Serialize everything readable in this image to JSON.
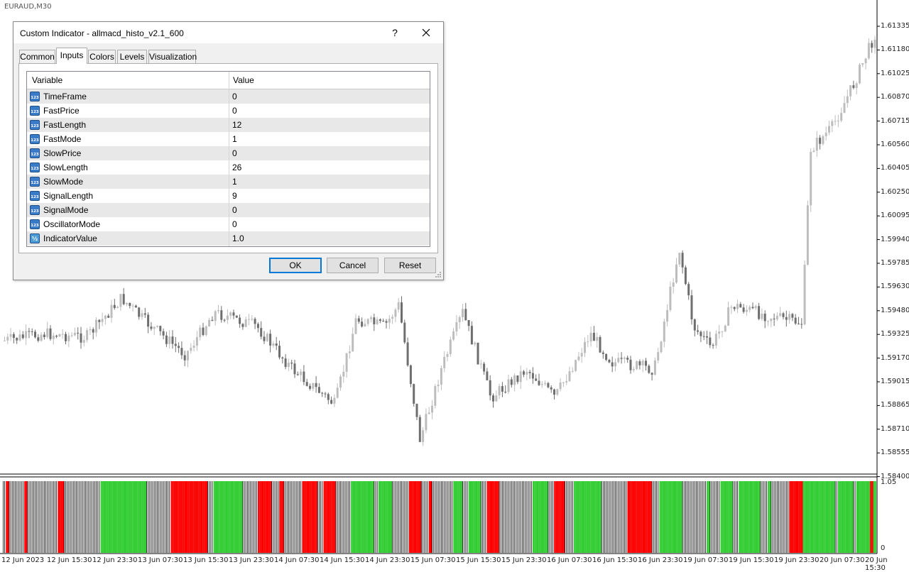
{
  "symbol": "EURAUD,M30",
  "price_axis": [
    "1.61335",
    "1.61180",
    "1.61025",
    "1.60870",
    "1.60715",
    "1.60560",
    "1.60405",
    "1.60250",
    "1.60095",
    "1.59940",
    "1.59785",
    "1.59630",
    "1.59480",
    "1.59325",
    "1.59170",
    "1.59015",
    "1.58865",
    "1.58710",
    "1.58555",
    "1.58400"
  ],
  "time_axis": [
    "12 Jun 2023",
    "12 Jun 15:30",
    "12 Jun 23:30",
    "13 Jun 07:30",
    "13 Jun 15:30",
    "13 Jun 23:30",
    "14 Jun 07:30",
    "14 Jun 15:30",
    "14 Jun 23:30",
    "15 Jun 07:30",
    "15 Jun 15:30",
    "15 Jun 23:30",
    "16 Jun 07:30",
    "16 Jun 15:30",
    "16 Jun 23:30",
    "19 Jun 07:30",
    "19 Jun 15:30",
    "19 Jun 23:30",
    "20 Jun 07:30",
    "20 Jun 15:30"
  ],
  "subwindow_axis": [
    "1.05",
    "0"
  ],
  "colors": {
    "up_candle": "#bdbdbd",
    "down_candle": "#6e6e6e",
    "histo_green": "#32cd32",
    "histo_red": "#ff0000",
    "accent": "#0078d7"
  },
  "dialog": {
    "title": "Custom Indicator - allmacd_histo_v2.1_600",
    "help_label": "?",
    "close_icon": "close-icon",
    "tabs": [
      {
        "label": "Common"
      },
      {
        "label": "Inputs"
      },
      {
        "label": "Colors"
      },
      {
        "label": "Levels"
      },
      {
        "label": "Visualization"
      }
    ],
    "active_tab": "Inputs",
    "table": {
      "col_variable": "Variable",
      "col_value": "Value",
      "rows": [
        {
          "name": "TimeFrame",
          "value": "0",
          "icon": "int-icon"
        },
        {
          "name": "FastPrice",
          "value": "0",
          "icon": "int-icon"
        },
        {
          "name": "FastLength",
          "value": "12",
          "icon": "int-icon"
        },
        {
          "name": "FastMode",
          "value": "1",
          "icon": "int-icon"
        },
        {
          "name": "SlowPrice",
          "value": "0",
          "icon": "int-icon"
        },
        {
          "name": "SlowLength",
          "value": "26",
          "icon": "int-icon"
        },
        {
          "name": "SlowMode",
          "value": "1",
          "icon": "int-icon"
        },
        {
          "name": "SignalLength",
          "value": "9",
          "icon": "int-icon"
        },
        {
          "name": "SignalMode",
          "value": "0",
          "icon": "int-icon"
        },
        {
          "name": "OscillatorMode",
          "value": "0",
          "icon": "int-icon"
        },
        {
          "name": "IndicatorValue",
          "value": "1.0",
          "icon": "double-icon"
        }
      ]
    },
    "buttons": {
      "ok": "OK",
      "cancel": "Cancel",
      "reset": "Reset"
    }
  }
}
